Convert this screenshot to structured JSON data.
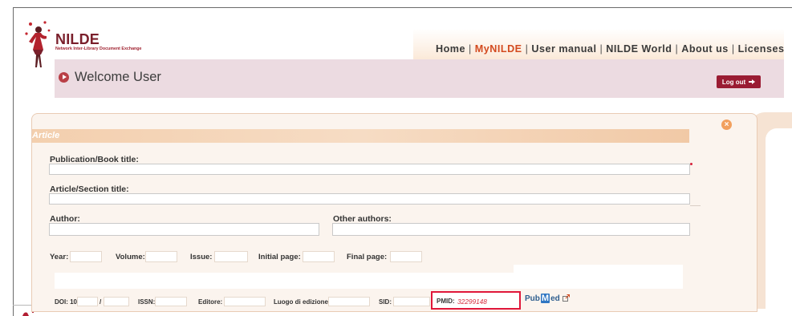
{
  "brand": {
    "name": "NILDE",
    "tagline": "Network Inter-Library Document Exchange"
  },
  "nav": {
    "items": [
      "Home",
      "MyNILDE",
      "User manual",
      "NILDE World",
      "About us",
      "Licenses"
    ],
    "active": "MyNILDE",
    "separator": "|"
  },
  "welcome": {
    "text": "Welcome User",
    "logout_label": "Log out"
  },
  "form": {
    "close_icon": "×",
    "section_title": "Article",
    "publication_title_label": "Publication/Book title:",
    "publication_title_value": "",
    "article_title_label": "Article/Section title:",
    "article_title_value": "",
    "author_label": "Author:",
    "author_value": "",
    "other_authors_label": "Other authors:",
    "other_authors_value": "",
    "year_label": "Year:",
    "volume_label": "Volume:",
    "issue_label": "Issue:",
    "initial_page_label": "Initial page:",
    "final_page_label": "Final page:",
    "doi_label": "DOI: 10.",
    "doi_separator": "/",
    "issn_label": "ISSN:",
    "editore_label": "Editore:",
    "luogo_label": "Luogo di edizione:",
    "sid_label": "SID:",
    "pmid_label": "PMID:",
    "pmid_value": "32299148",
    "pubmed_label_left": "Pub",
    "pubmed_label_m": "M",
    "pubmed_label_right": "ed"
  },
  "colors": {
    "brand_red": "#7a1f2b",
    "nav_active": "#d34a1f",
    "logout_bg": "#9a1c33",
    "pmid_highlight": "#e0173a",
    "section_header": "#f3cfae"
  },
  "icons": {
    "logo": "nilde-figure-icon",
    "welcome": "play-circle-icon",
    "logout": "arrow-right-icon",
    "close": "close-circle-icon",
    "pubmed": "pubmed-logo-icon",
    "external": "external-link-icon"
  }
}
